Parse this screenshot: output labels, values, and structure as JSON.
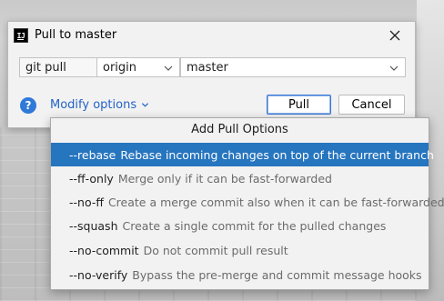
{
  "dialog": {
    "title": "Pull to master",
    "app_icon_text": "IJ",
    "command": "git pull",
    "remote": "origin",
    "branch": "master",
    "modify_options_label": "Modify options",
    "pull_button": "Pull",
    "cancel_button": "Cancel",
    "help_label": "?"
  },
  "popup": {
    "header": "Add Pull Options",
    "options": [
      {
        "flag": "--rebase",
        "description": "Rebase incoming changes on top of the current branch",
        "selected": true
      },
      {
        "flag": "--ff-only",
        "description": "Merge only if it can be fast-forwarded",
        "selected": false
      },
      {
        "flag": "--no-ff",
        "description": "Create a merge commit also when it can be fast-forwarded",
        "selected": false
      },
      {
        "flag": "--squash",
        "description": "Create a single commit for the pulled changes",
        "selected": false
      },
      {
        "flag": "--no-commit",
        "description": "Do not commit pull result",
        "selected": false
      },
      {
        "flag": "--no-verify",
        "description": "Bypass the pre-merge and commit message hooks",
        "selected": false
      }
    ]
  },
  "colors": {
    "selection": "#2675bf",
    "link": "#2462c7",
    "help": "#2f7ad9"
  }
}
